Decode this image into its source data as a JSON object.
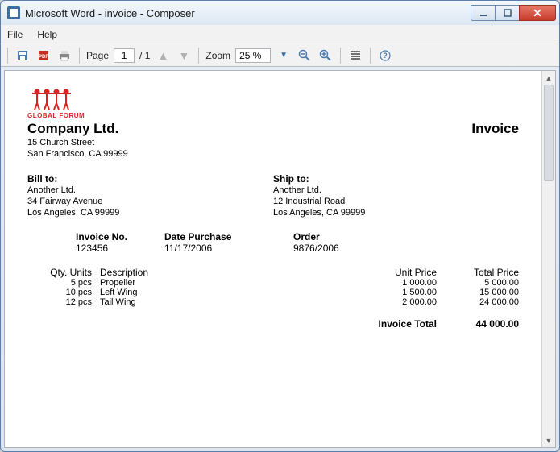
{
  "window": {
    "title": "Microsoft Word - invoice - Composer"
  },
  "menu": {
    "file": "File",
    "help": "Help"
  },
  "toolbar": {
    "page_label": "Page",
    "page_current": "1",
    "page_total": "/ 1",
    "zoom_label": "Zoom",
    "zoom_value": "25 %"
  },
  "doc": {
    "logo_text": "GLOBAL FORUM",
    "company_name": "Company Ltd.",
    "company_addr1": "15 Church Street",
    "company_addr2": "San Francisco, CA 99999",
    "invoice_title": "Invoice",
    "bill_label": "Bill to:",
    "bill_name": "Another Ltd.",
    "bill_addr1": "34 Fairway Avenue",
    "bill_addr2": "Los Angeles, CA 99999",
    "ship_label": "Ship to:",
    "ship_name": "Another Ltd.",
    "ship_addr1": "12 Industrial Road",
    "ship_addr2": "Los Angeles, CA 99999",
    "invno_label": "Invoice No.",
    "invno_val": "123456",
    "date_label": "Date Purchase",
    "date_val": "11/17/2006",
    "order_label": "Order",
    "order_val": "9876/2006",
    "th_qty": "Qty. Units",
    "th_desc": "Description",
    "th_unit": "Unit Price",
    "th_total": "Total Price",
    "rows": [
      {
        "qty": "5 pcs",
        "desc": "Propeller",
        "unit": "1 000.00",
        "total": "5 000.00"
      },
      {
        "qty": "10 pcs",
        "desc": "Left Wing",
        "unit": "1 500.00",
        "total": "15 000.00"
      },
      {
        "qty": "12 pcs",
        "desc": "Tail Wing",
        "unit": "2 000.00",
        "total": "24 000.00"
      }
    ],
    "total_label": "Invoice Total",
    "total_val": "44 000.00"
  }
}
